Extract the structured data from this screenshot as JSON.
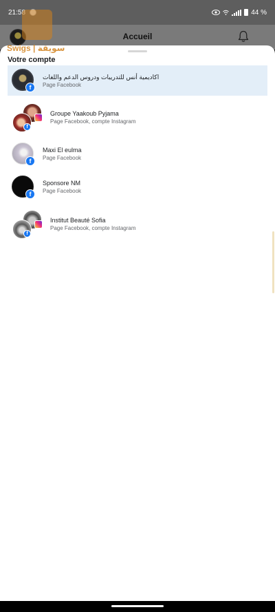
{
  "status_bar": {
    "time": "21:58",
    "battery_text": "44 %",
    "icons": [
      "notification-icon",
      "eye-icon",
      "wifi-icon",
      "signal-icon",
      "battery-icon"
    ]
  },
  "header": {
    "title": "Accueil",
    "icons": [
      "profile-avatar",
      "bell-icon"
    ]
  },
  "watermark": {
    "brand_text": "Swigs | سويقة"
  },
  "sheet": {
    "section_title": "Votre compte",
    "accounts": [
      {
        "name": "اكاديمية أنس للتدريبات ودروس الدعم واللغات",
        "subtitle": "Page Facebook",
        "selected": true,
        "badges": [
          "facebook"
        ]
      },
      {
        "name": "Groupe Yaakoub Pyjama",
        "subtitle": "Page Facebook, compte Instagram",
        "selected": false,
        "badges": [
          "facebook",
          "instagram"
        ]
      },
      {
        "name": "Maxi El eulma",
        "subtitle": "Page Facebook",
        "selected": false,
        "badges": [
          "facebook"
        ]
      },
      {
        "name": "Sponsore NM",
        "subtitle": "Page Facebook",
        "selected": false,
        "badges": [
          "facebook"
        ]
      },
      {
        "name": "Institut Beauté Sofia",
        "subtitle": "Page Facebook, compte Instagram",
        "selected": false,
        "badges": [
          "facebook",
          "instagram"
        ]
      }
    ]
  },
  "colors": {
    "accent_facebook": "#1877f2",
    "selected_row": "#e3eef8",
    "overlay_header": "#7a7a7a",
    "status_bar": "#5e5e5e"
  }
}
